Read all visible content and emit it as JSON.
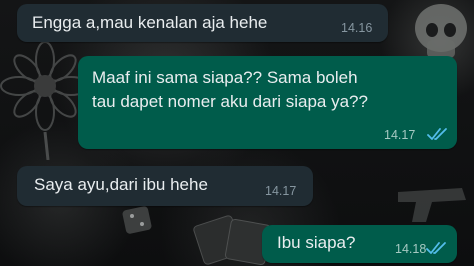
{
  "messages": [
    {
      "direction": "incoming",
      "text_lines": [
        "Engga a,mau kenalan aja hehe"
      ],
      "time": "14.16"
    },
    {
      "direction": "outgoing",
      "text_lines": [
        "Maaf ini sama siapa?? Sama boleh",
        "tau dapet nomer aku dari siapa ya??"
      ],
      "time": "14.17",
      "status_icon": "double-check-read-icon"
    },
    {
      "direction": "incoming",
      "text_lines": [
        "Saya ayu,dari ibu hehe"
      ],
      "time": "14.17"
    },
    {
      "direction": "outgoing",
      "text_lines": [
        "Ibu siapa?"
      ],
      "time": "14.18",
      "status_icon": "double-check-read-icon"
    }
  ],
  "colors": {
    "incoming_bubble": "#202c33",
    "outgoing_bubble": "#005c4b",
    "text": "#e9edef",
    "timestamp": "#8696a0",
    "read_tick": "#53bdeb"
  }
}
